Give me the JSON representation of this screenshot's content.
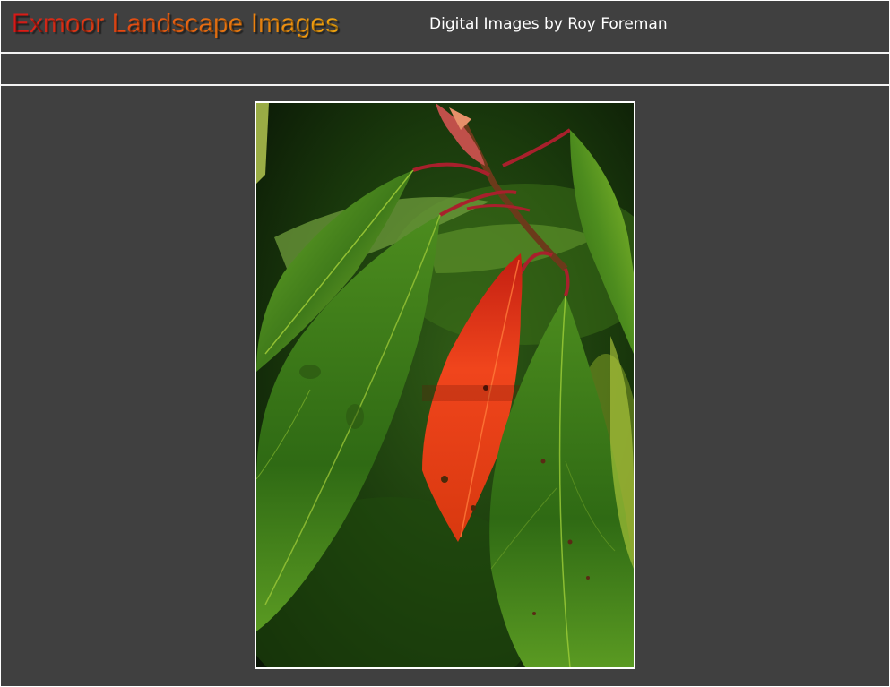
{
  "header": {
    "title": "Exmoor Landscape Images",
    "subtitle": "Digital Images by Roy Foreman"
  },
  "photo": {
    "subject": "red-leaf-among-green-leaves",
    "colors": {
      "background": "#404040",
      "frame_border": "#ffffff",
      "title_gradient_start": "#d81818",
      "title_gradient_end": "#f2a70e",
      "leaf_red": "#e8381a",
      "leaf_green": "#4f8a1e",
      "stem": "#a8202c"
    }
  }
}
